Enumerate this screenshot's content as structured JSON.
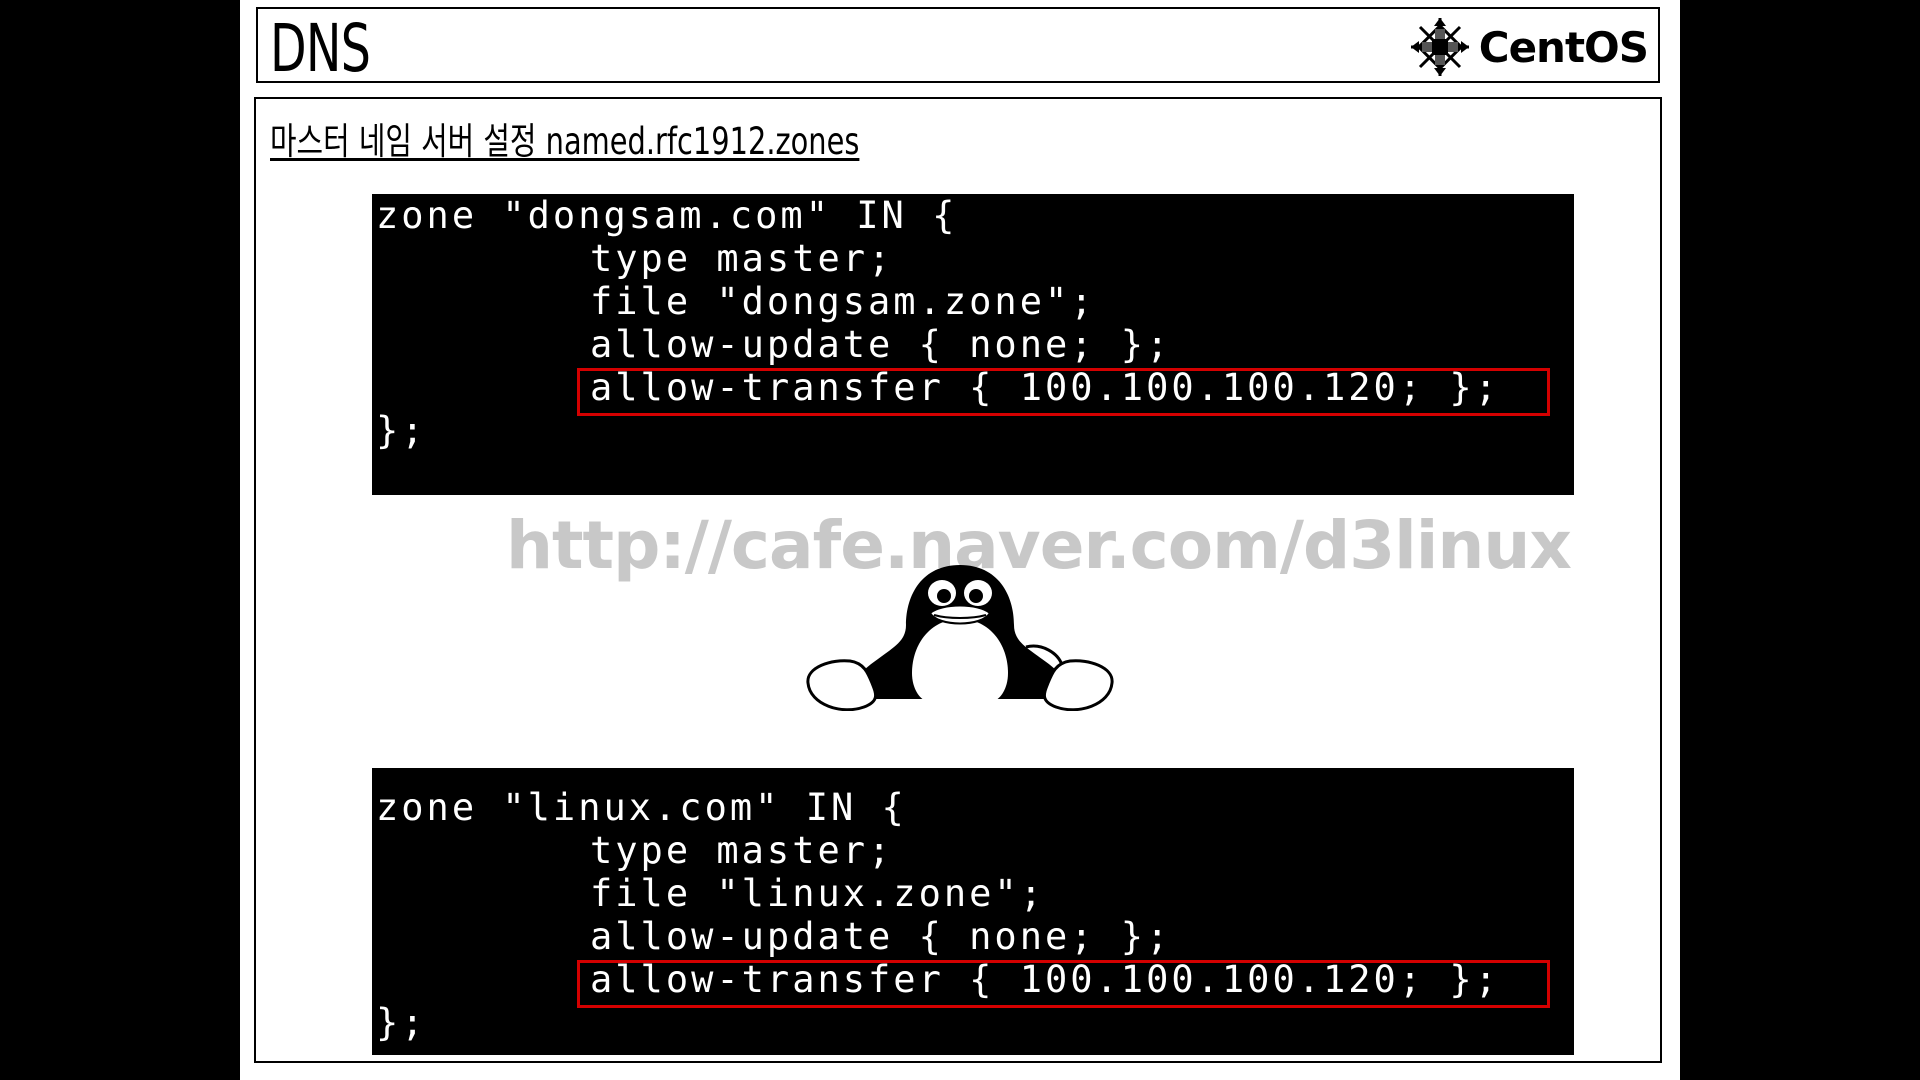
{
  "title": "DNS",
  "logo": {
    "text": "CentOS"
  },
  "subtitle": "마스터 네임 서버 설정 named.rfc1912.zones",
  "code_blocks": [
    {
      "lines": [
        "zone \"dongsam.com\" IN {",
        "type master;",
        "file \"dongsam.zone\";",
        "allow-update { none; };",
        "allow-transfer { 100.100.100.120; };",
        "};"
      ],
      "highlighted_line": "allow-transfer { 100.100.100.120; };"
    },
    {
      "lines": [
        "zone \"linux.com\" IN {",
        "type master;",
        "file \"linux.zone\";",
        "allow-update { none; };",
        "allow-transfer { 100.100.100.120; };",
        "};"
      ],
      "highlighted_line": "allow-transfer { 100.100.100.120; };"
    }
  ],
  "watermark": "http://cafe.naver.com/d3linux",
  "colors": {
    "highlight_border": "#d40000",
    "terminal_bg": "#000000",
    "terminal_text": "#ffffff",
    "watermark": "#c8c8c8"
  },
  "icons": {
    "logo": "centos-logo-icon",
    "mascot": "tux-penguin-icon"
  }
}
